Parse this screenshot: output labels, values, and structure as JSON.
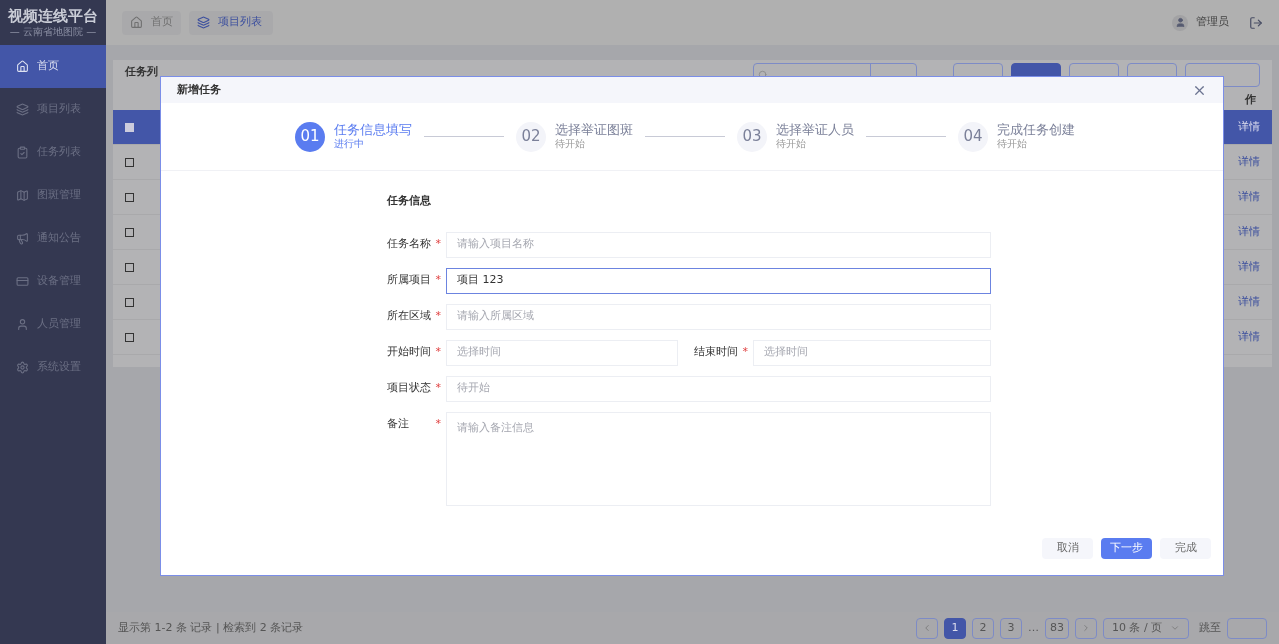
{
  "logo": {
    "title": "视频连线平台",
    "subtitle": "— 云南省地图院 —"
  },
  "sidebar": {
    "items": [
      {
        "label": "首页",
        "selected": true
      },
      {
        "label": "项目列表",
        "selected": false
      },
      {
        "label": "任务列表",
        "selected": false
      },
      {
        "label": "图斑管理",
        "selected": false
      },
      {
        "label": "通知公告",
        "selected": false
      },
      {
        "label": "设备管理",
        "selected": false
      },
      {
        "label": "人员管理",
        "selected": false
      },
      {
        "label": "系统设置",
        "selected": false
      }
    ]
  },
  "breadcrumbs": [
    {
      "label": "首页",
      "selected": false
    },
    {
      "label": "项目列表",
      "selected": true
    }
  ],
  "user": {
    "name": "管理员"
  },
  "panel": {
    "title": "任务列",
    "buttons": [
      {
        "primary": false
      },
      {
        "primary": true
      },
      {
        "primary": false
      },
      {
        "primary": false
      },
      {
        "primary": false
      }
    ],
    "column_last": "作",
    "rows": [
      {
        "selected": true,
        "action": "详情"
      },
      {
        "selected": false,
        "action": "详情"
      },
      {
        "selected": false,
        "action": "详情"
      },
      {
        "selected": false,
        "action": "详情"
      },
      {
        "selected": false,
        "action": "详情"
      },
      {
        "selected": false,
        "action": "详情"
      },
      {
        "selected": false,
        "action": "详情"
      }
    ]
  },
  "footer": {
    "summary": "显示第 1-2 条 记录 | 检索到 2 条记录",
    "pages": [
      {
        "label": "1",
        "selected": true
      },
      {
        "label": "2",
        "selected": false
      },
      {
        "label": "3",
        "selected": false
      },
      {
        "label": "…",
        "kind": "ellipsis"
      },
      {
        "label": "83",
        "selected": false
      }
    ],
    "page_size": "10 条 / 页",
    "jump_label": "跳至"
  },
  "dialog": {
    "title": "新增任务",
    "steps": [
      {
        "number": "01",
        "title": "任务信息填写",
        "status": "进行中",
        "selected": true
      },
      {
        "number": "02",
        "title": "选择举证图斑",
        "status": "待开始",
        "selected": false
      },
      {
        "number": "03",
        "title": "选择举证人员",
        "status": "待开始",
        "selected": false
      },
      {
        "number": "04",
        "title": "完成任务创建",
        "status": "待开始",
        "selected": false
      }
    ],
    "section_title": "任务信息",
    "rows": [
      [
        {
          "label": "任务名称",
          "mark": "*",
          "placeholder": "请输入项目名称",
          "focused": false
        }
      ],
      [
        {
          "label": "所属项目",
          "mark": "*",
          "value": "项目 123",
          "focused": true
        }
      ],
      [
        {
          "label": "所在区域",
          "mark": "*",
          "placeholder": "请输入所属区域",
          "focused": false
        }
      ],
      [
        {
          "label": "开始时间",
          "mark": "*",
          "placeholder": "选择时间",
          "focused": false
        },
        {
          "label": "结束时间",
          "mark": "*",
          "placeholder": "选择时间",
          "focused": false
        }
      ],
      [
        {
          "label": "项目状态",
          "mark": "*",
          "placeholder": "待开始",
          "focused": false
        }
      ],
      [
        {
          "label": "备注",
          "mark": "*",
          "placeholder": "请输入备注信息",
          "focused": false,
          "kind": "textarea"
        }
      ]
    ],
    "buttons": [
      {
        "label": "取消",
        "primary": false
      },
      {
        "label": "下一步",
        "primary": true
      },
      {
        "label": "完成",
        "primary": false
      }
    ]
  }
}
